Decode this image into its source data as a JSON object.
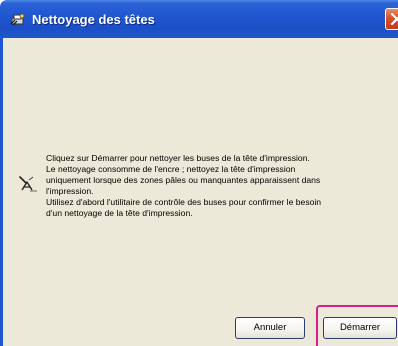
{
  "window": {
    "title": "Nettoyage des têtes",
    "title_icon": "printer-head-cleaning-icon",
    "close_icon": "close-icon"
  },
  "message": {
    "icon": "nozzle-cleaning-icon",
    "lines": [
      "Cliquez sur Démarrer pour nettoyer les buses de la tête d'impression.",
      "Le nettoyage consomme de l'encre ; nettoyez la tête d'impression",
      "uniquement lorsque des zones pâles ou manquantes apparaissent dans",
      "l'impression.",
      "Utilisez d'abord l'utilitaire de contrôle des buses pour confirmer le besoin",
      "d'un nettoyage de la tête d'impression."
    ]
  },
  "buttons": {
    "cancel_label": "Annuler",
    "start_label": "Démarrer"
  },
  "colors": {
    "titlebar": "#1f55cf",
    "dialog_background": "#ece9d8",
    "highlight": "#d81d8c",
    "close_button": "#d8512c"
  }
}
